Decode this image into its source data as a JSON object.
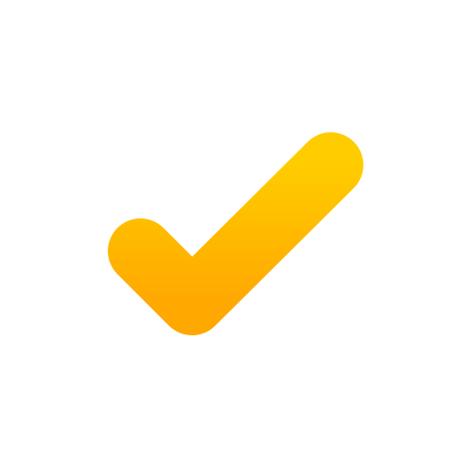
{
  "icon": {
    "name": "checkmark-icon",
    "colors": {
      "gradient_top": "#FFCC00",
      "gradient_bottom": "#FFA800",
      "background": "#FFFFFF"
    }
  }
}
